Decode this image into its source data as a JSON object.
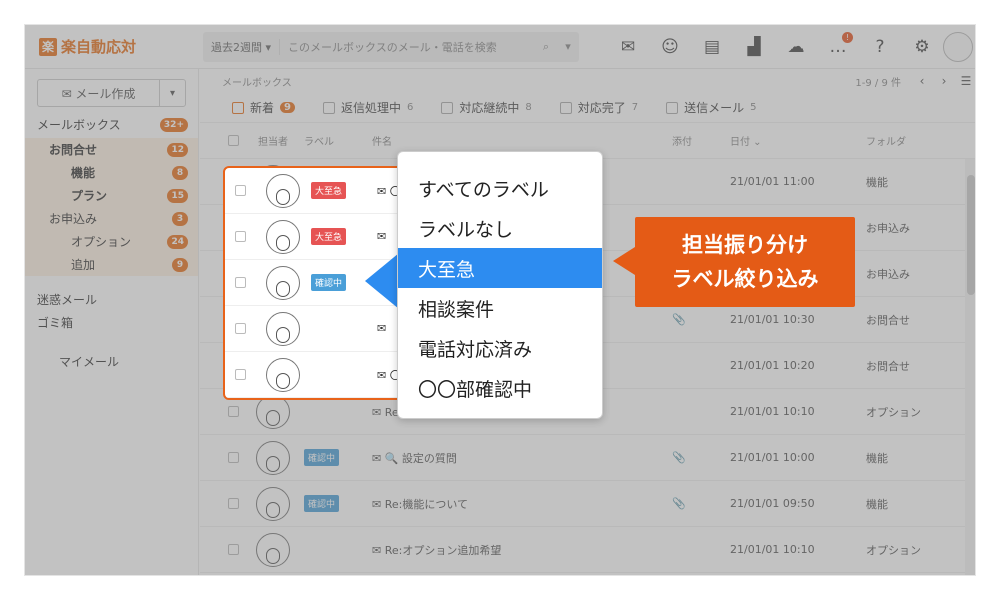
{
  "app": {
    "logo_mark": "楽",
    "logo_text": "楽自動応対"
  },
  "header": {
    "period": "過去2週間 ▾",
    "search_placeholder": "このメールボックスのメール・電話を検索",
    "search_icon": "search-icon",
    "notification_badge": "!"
  },
  "sidebar": {
    "compose_label": "✉ メール作成",
    "compose_dropdown": "▾",
    "mailbox": {
      "label": "メールボックス",
      "count": "32+"
    },
    "groups": [
      {
        "label": "お問合せ",
        "count": "12"
      },
      {
        "label": "機能",
        "count": "8"
      },
      {
        "label": "プラン",
        "count": "15"
      },
      {
        "label": "お申込み",
        "count": "3"
      },
      {
        "label": "オプション",
        "count": "24"
      },
      {
        "label": "追加",
        "count": "9"
      }
    ],
    "spam": "迷惑メール",
    "trash": "ゴミ箱",
    "my_mail": "マイメール"
  },
  "main": {
    "breadcrumb": "メールボックス",
    "pagination": "1-9 / 9 件",
    "prev": "‹",
    "next": "›",
    "tabs": [
      {
        "label": "新着",
        "count": "9"
      },
      {
        "label": "返信処理中",
        "count": "6"
      },
      {
        "label": "対応継続中",
        "count": "8"
      },
      {
        "label": "対応完了",
        "count": "7"
      },
      {
        "label": "送信メール",
        "count": "5"
      }
    ],
    "columns": {
      "assignee": "担当者",
      "label": "ラベル",
      "subject": "件名",
      "attachment": "添付",
      "date": "日付 ⌄",
      "folder": "フォルダ"
    },
    "rows": [
      {
        "label": "大至急",
        "label_color": "red",
        "subject": "✉ 〇",
        "att": "",
        "date": "21/01/01 11:00",
        "folder": "機能"
      },
      {
        "label": "大至急",
        "label_color": "red",
        "subject": "✉",
        "att": "",
        "date": "",
        "folder": "お申込み"
      },
      {
        "label": "確認中",
        "label_color": "blue",
        "subject": "✉",
        "att": "",
        "date": "",
        "folder": "お申込み"
      },
      {
        "label": "",
        "label_color": "",
        "subject": "✉",
        "att": "📎",
        "date": "21/01/01 10:30",
        "folder": "お問合せ"
      },
      {
        "label": "",
        "label_color": "",
        "subject": "✉ 〇",
        "att": "",
        "date": "21/01/01 10:20",
        "folder": "お問合せ"
      },
      {
        "label": "",
        "label_color": "",
        "subject": "✉ Re:オプション追加希望",
        "att": "",
        "date": "21/01/01 10:10",
        "folder": "オプション"
      },
      {
        "label": "確認中",
        "label_color": "blue",
        "subject": "✉ 🔍 設定の質問",
        "att": "📎",
        "date": "21/01/01 10:00",
        "folder": "機能"
      },
      {
        "label": "確認中",
        "label_color": "blue",
        "subject": "✉ Re:機能について",
        "att": "📎",
        "date": "21/01/01 09:50",
        "folder": "機能"
      },
      {
        "label": "",
        "label_color": "",
        "subject": "✉ Re:オプション追加希望",
        "att": "",
        "date": "21/01/01 10:10",
        "folder": "オプション"
      }
    ]
  },
  "label_menu": {
    "items": [
      "すべてのラベル",
      "ラベルなし",
      "大至急",
      "相談案件",
      "電話対応済み",
      "〇〇部確認中"
    ],
    "selected_index": 2
  },
  "callout": {
    "line1": "担当振り分け",
    "line2": "ラベル絞り込み"
  },
  "colors": {
    "accent": "#e8701a",
    "callout": "#e45b16",
    "selected": "#2d8cf0",
    "urgent": "#e65454",
    "checking": "#4a9fd8"
  }
}
